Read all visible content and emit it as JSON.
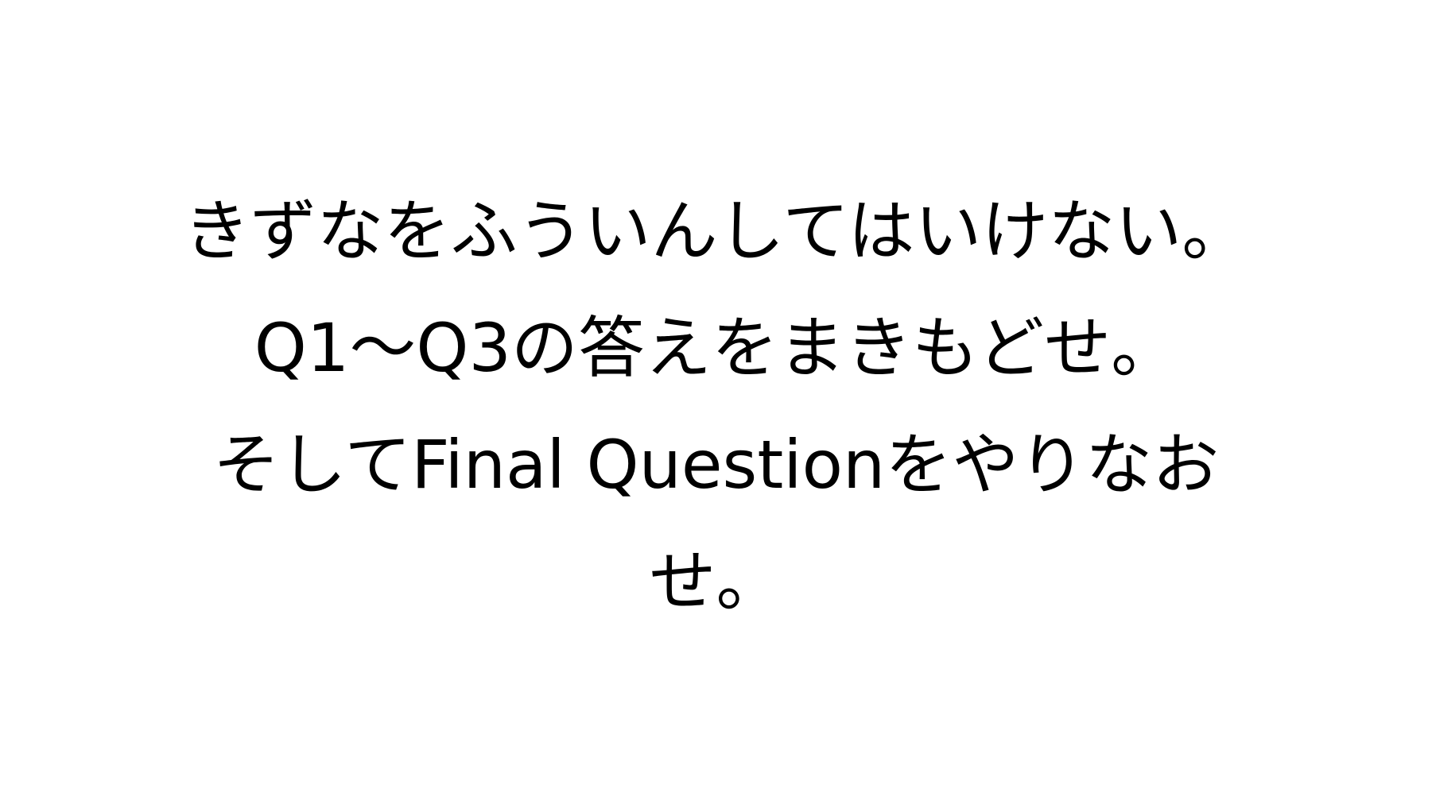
{
  "message": {
    "lines": [
      "きずなをふういんしてはいけない。",
      "Q1〜Q3の答えをまきもどせ。",
      "そしてFinal Questionをやりなお",
      "せ。"
    ]
  },
  "colors": {
    "background": "#ffffff",
    "text": "#000000"
  }
}
